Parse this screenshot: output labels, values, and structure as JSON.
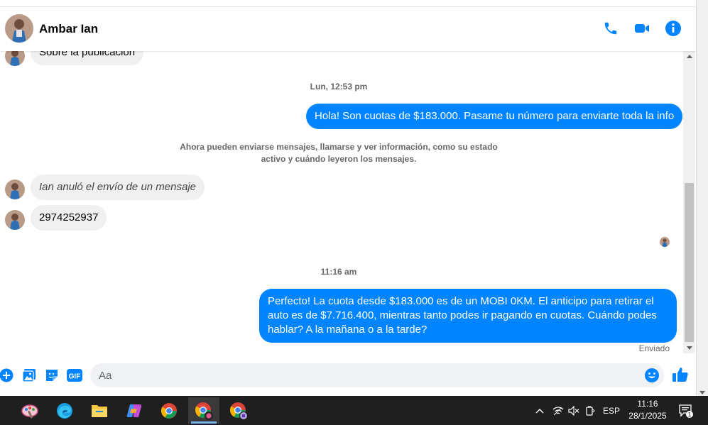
{
  "header": {
    "contact_name": "Ambar Ian",
    "icons": [
      "phone-icon",
      "video-camera-icon",
      "info-icon"
    ],
    "accent": "#0084ff"
  },
  "thread": {
    "partial_top_message": "Sobre la publicación",
    "timestamp_1": "Lun, 12:53 pm",
    "outgoing_1": "Hola! Son cuotas de $183.000. Pasame tu número para enviarte toda la info",
    "system_line_1": "Ahora pueden enviarse mensajes, llamarse y ver información, como su estado",
    "system_line_2": "activo y cuándo leyeron los mensajes.",
    "unsent_notice": "Ian anuló el envío de un mensaje",
    "incoming_number": "2974252937",
    "timestamp_2": "11:16 am",
    "outgoing_2": "Perfecto! La cuota desde $183.000 es de un MOBI 0KM. El anticipo para retirar el auto es de $7.716.400, mientras tanto podes ir pagando en cuotas. Cuándo podes hablar? A la mañana o a la tarde?",
    "status": "Enviado"
  },
  "composer": {
    "placeholder": "Aa",
    "icons": [
      "add-icon",
      "image-icon",
      "sticker-icon",
      "gif-icon",
      "emoji-icon",
      "thumbs-up-icon"
    ],
    "gif_label": "GIF"
  },
  "taskbar": {
    "apps": [
      "paint-icon",
      "edge-icon",
      "file-explorer-icon",
      "copilot-icon",
      "chrome-icon",
      "chrome-profile-icon",
      "chrome-profile-2-icon"
    ],
    "language": "ESP",
    "time": "11:16",
    "date": "28/1/2025",
    "notification_count": "1"
  }
}
